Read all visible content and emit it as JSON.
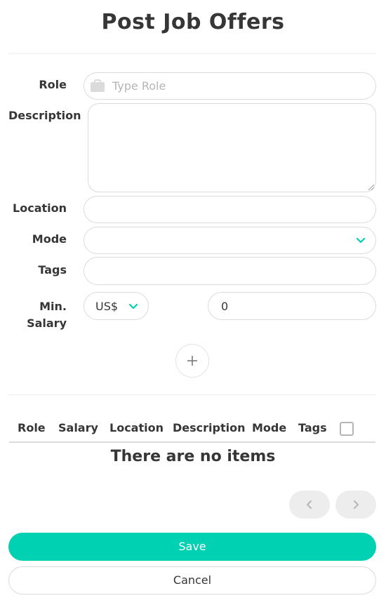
{
  "page": {
    "title": "Post Job Offers"
  },
  "form": {
    "role": {
      "label": "Role",
      "placeholder": "Type Role",
      "icon": "briefcase-icon"
    },
    "description": {
      "label": "Description",
      "value": ""
    },
    "location": {
      "label": "Location",
      "value": ""
    },
    "mode": {
      "label": "Mode",
      "value": "",
      "icon": "chevron-down-icon"
    },
    "tags": {
      "label": "Tags",
      "value": ""
    },
    "min_salary": {
      "label_line1": "Min.",
      "label_line2": "Salary",
      "currency": "US$",
      "amount": "0"
    },
    "add_icon": "plus-icon"
  },
  "table": {
    "columns": [
      "Role",
      "Salary",
      "Location",
      "Description",
      "Mode",
      "Tags"
    ],
    "empty_message": "There are no items"
  },
  "pagination": {
    "prev_icon": "chevron-left-icon",
    "next_icon": "chevron-right-icon"
  },
  "actions": {
    "save_label": "Save",
    "cancel_label": "Cancel"
  },
  "colors": {
    "primary": "#00d1b2",
    "text": "#363636",
    "placeholder": "#b5b5b5",
    "border": "#dbdbdb"
  }
}
